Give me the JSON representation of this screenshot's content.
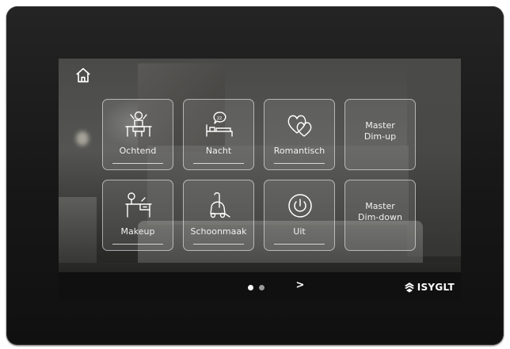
{
  "home": {
    "icon": "home-icon"
  },
  "tiles": [
    {
      "label": "Ochtend",
      "icon": "person-at-desk-icon"
    },
    {
      "label": "Nacht",
      "icon": "bed-sleep-icon"
    },
    {
      "label": "Romantisch",
      "icon": "hearts-icon"
    },
    {
      "label": "Master\nDim-up"
    },
    {
      "label": "Makeup",
      "icon": "vanity-desk-icon"
    },
    {
      "label": "Schoonmaak",
      "icon": "vacuum-cleaner-icon"
    },
    {
      "label": "Uit",
      "icon": "power-icon"
    },
    {
      "label": "Master\nDim-down"
    }
  ],
  "pager": {
    "current_page": 1,
    "page_count": 2,
    "next_label": ">"
  },
  "brand": {
    "name": "ISYGLT",
    "icon": "brand-logo-icon"
  },
  "colors": {
    "bezel": "#1a1a1a",
    "bar": "#101010",
    "tile_border": "#ffffff"
  }
}
